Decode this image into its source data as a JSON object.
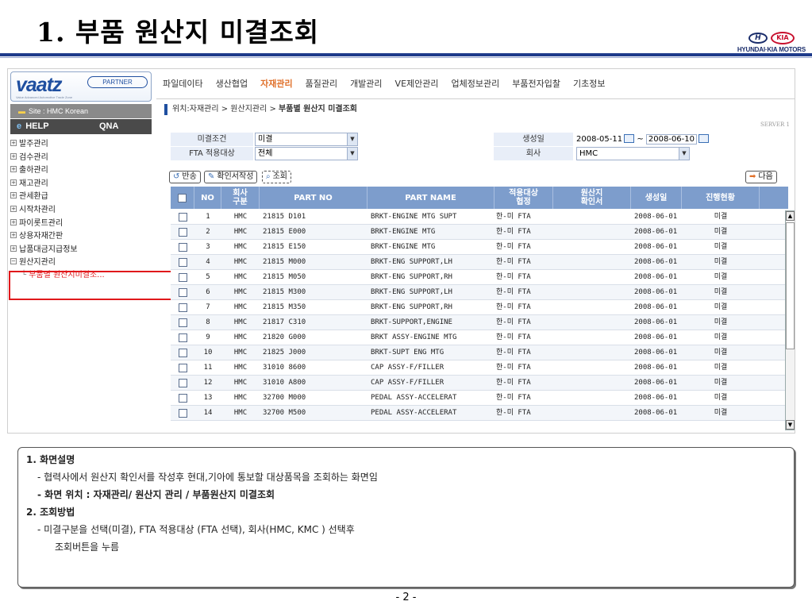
{
  "slide": {
    "title_num": "1.",
    "title_text": "부품 원산지 미결조회",
    "page": "- 2 -"
  },
  "logo": {
    "hy": "H",
    "kia": "KIA",
    "text": "HYUNDAI·KIA MOTORS"
  },
  "sidebar": {
    "brand": "vaatz",
    "partner": "PARTNER",
    "tagline": "Value Advanced Automotive Trade Zone",
    "site": "Site :  HMC Korean",
    "help": "HELP",
    "qna": "QNA",
    "items": [
      {
        "label": "발주관리",
        "open": false
      },
      {
        "label": "검수관리",
        "open": false
      },
      {
        "label": "출하관리",
        "open": false
      },
      {
        "label": "재고관리",
        "open": false
      },
      {
        "label": "관세환급",
        "open": false
      },
      {
        "label": "시작차관리",
        "open": false
      },
      {
        "label": "파이롯트관리",
        "open": false
      },
      {
        "label": "상용자재간판",
        "open": false
      },
      {
        "label": "납품대금지급정보",
        "open": false
      },
      {
        "label": "원산지관리",
        "open": true
      }
    ],
    "sub_item": "부품별 원산지미결조..."
  },
  "menu": [
    {
      "label": "파일데이타",
      "active": false
    },
    {
      "label": "생산협업",
      "active": false
    },
    {
      "label": "자재관리",
      "active": true
    },
    {
      "label": "품질관리",
      "active": false
    },
    {
      "label": "개발관리",
      "active": false
    },
    {
      "label": "VE제안관리",
      "active": false
    },
    {
      "label": "업체정보관리",
      "active": false
    },
    {
      "label": "부품전자입찰",
      "active": false
    },
    {
      "label": "기초정보",
      "active": false
    }
  ],
  "location": {
    "prefix": "위치:자재관리 > 원산지관리 > ",
    "current": "부품별 원산지 미결조회"
  },
  "server": "SERVER 1",
  "filters": {
    "status_label": "미결조건",
    "status_value": "미결",
    "fta_label": "FTA 적용대상",
    "fta_value": "전체",
    "created_label": "생성일",
    "date_from": "2008-05-11",
    "tilde": "~",
    "date_to": "2008-06-10",
    "company_label": "회사",
    "company_value": "HMC"
  },
  "buttons": {
    "return": "반송",
    "confirm": "확인서작성",
    "search": "조회",
    "next": "다음"
  },
  "table": {
    "headers": {
      "no": "NO",
      "company": "회사\n구분",
      "part_no": "PART NO",
      "part_name": "PART NAME",
      "agreement": "적용대상\n협정",
      "certificate": "원산지\n확인서",
      "created": "생성일",
      "status": "진행현황"
    },
    "rows": [
      {
        "no": "1",
        "company": "HMC",
        "part_no": "21815 D101",
        "part_name": "BRKT-ENGINE MTG SUPT",
        "agreement": "한-미 FTA",
        "certificate": "",
        "created": "2008-06-01",
        "status": "미결"
      },
      {
        "no": "2",
        "company": "HMC",
        "part_no": "21815 E000",
        "part_name": "BRKT-ENGINE MTG",
        "agreement": "한-미 FTA",
        "certificate": "",
        "created": "2008-06-01",
        "status": "미결"
      },
      {
        "no": "3",
        "company": "HMC",
        "part_no": "21815 E150",
        "part_name": "BRKT-ENGINE MTG",
        "agreement": "한-미 FTA",
        "certificate": "",
        "created": "2008-06-01",
        "status": "미결"
      },
      {
        "no": "4",
        "company": "HMC",
        "part_no": "21815 M000",
        "part_name": "BRKT-ENG SUPPORT,LH",
        "agreement": "한-미 FTA",
        "certificate": "",
        "created": "2008-06-01",
        "status": "미결"
      },
      {
        "no": "5",
        "company": "HMC",
        "part_no": "21815 M050",
        "part_name": "BRKT-ENG SUPPORT,RH",
        "agreement": "한-미 FTA",
        "certificate": "",
        "created": "2008-06-01",
        "status": "미결"
      },
      {
        "no": "6",
        "company": "HMC",
        "part_no": "21815 M300",
        "part_name": "BRKT-ENG SUPPORT,LH",
        "agreement": "한-미 FTA",
        "certificate": "",
        "created": "2008-06-01",
        "status": "미결"
      },
      {
        "no": "7",
        "company": "HMC",
        "part_no": "21815 M350",
        "part_name": "BRKT-ENG SUPPORT,RH",
        "agreement": "한-미 FTA",
        "certificate": "",
        "created": "2008-06-01",
        "status": "미결"
      },
      {
        "no": "8",
        "company": "HMC",
        "part_no": "21817 C310",
        "part_name": "BRKT-SUPPORT,ENGINE",
        "agreement": "한-미 FTA",
        "certificate": "",
        "created": "2008-06-01",
        "status": "미결"
      },
      {
        "no": "9",
        "company": "HMC",
        "part_no": "21820 G000",
        "part_name": "BRKT ASSY-ENGINE MTG",
        "agreement": "한-미 FTA",
        "certificate": "",
        "created": "2008-06-01",
        "status": "미결"
      },
      {
        "no": "10",
        "company": "HMC",
        "part_no": "21825 J000",
        "part_name": "BRKT-SUPT ENG MTG",
        "agreement": "한-미 FTA",
        "certificate": "",
        "created": "2008-06-01",
        "status": "미결"
      },
      {
        "no": "11",
        "company": "HMC",
        "part_no": "31010 8600",
        "part_name": "CAP ASSY-F/FILLER",
        "agreement": "한-미 FTA",
        "certificate": "",
        "created": "2008-06-01",
        "status": "미결"
      },
      {
        "no": "12",
        "company": "HMC",
        "part_no": "31010 A800",
        "part_name": "CAP ASSY-F/FILLER",
        "agreement": "한-미 FTA",
        "certificate": "",
        "created": "2008-06-01",
        "status": "미결"
      },
      {
        "no": "13",
        "company": "HMC",
        "part_no": "32700 M000",
        "part_name": "PEDAL ASSY-ACCELERAT",
        "agreement": "한-미 FTA",
        "certificate": "",
        "created": "2008-06-01",
        "status": "미결"
      },
      {
        "no": "14",
        "company": "HMC",
        "part_no": "32700 M500",
        "part_name": "PEDAL ASSY-ACCELERAT",
        "agreement": "한-미 FTA",
        "certificate": "",
        "created": "2008-06-01",
        "status": "미결"
      }
    ]
  },
  "notes": [
    {
      "text": "1. 화면설명",
      "style": "b"
    },
    {
      "text": "-  협력사에서 원산지 확인서를 작성후  현대,기아에 통보할 대상품목을 조회하는 화면임",
      "style": "i"
    },
    {
      "text": "-  화면 위치 :  자재관리/ 원산지 관리 / 부품원산지 미결조회",
      "style": "i b"
    },
    {
      "text": "2. 조회방법",
      "style": "b"
    },
    {
      "text": "-  미결구분을 선택(미결), FTA 적용대상 (FTA 선택), 회사(HMC, KMC ) 선택후",
      "style": "i"
    },
    {
      "text": "조회버튼을 누름",
      "style": "i2"
    }
  ],
  "colors": {
    "accent": "#1f3b8b",
    "active_menu": "#e0702a",
    "highlight": "#e0181b",
    "table_header": "#7d9dcc"
  }
}
